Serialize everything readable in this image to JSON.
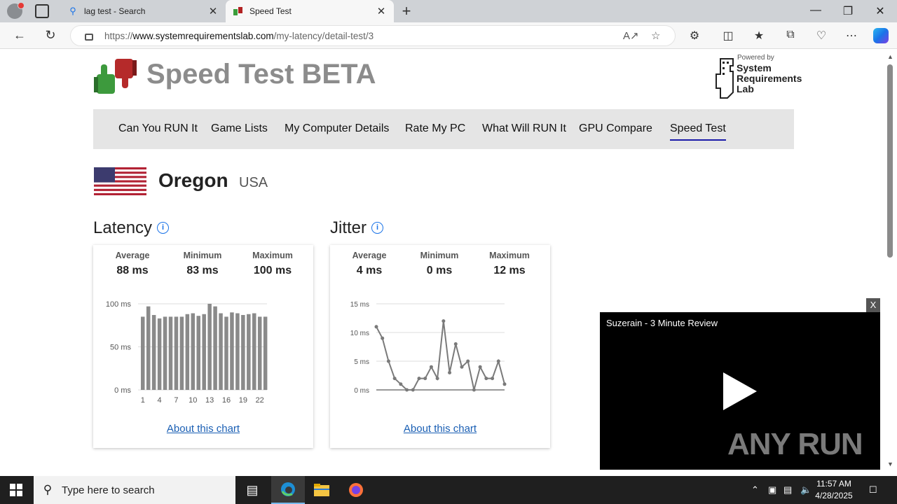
{
  "browser": {
    "tabs": [
      {
        "label": "lag test - Search",
        "icon": "search-icon",
        "active": false
      },
      {
        "label": "Speed Test",
        "icon": "srl-favicon",
        "active": true
      }
    ],
    "url_prefix": "https://",
    "url_domain": "www.systemrequirementslab.com",
    "url_path": "/my-latency/detail-test/3"
  },
  "site": {
    "title": "Speed Test BETA",
    "powered_by": "Powered by",
    "srl_lines": [
      "System",
      "Requirements",
      "Lab"
    ]
  },
  "menu": {
    "items": [
      {
        "label": "Can You RUN It",
        "active": false
      },
      {
        "label": "Game Lists",
        "active": false
      },
      {
        "label": "My Computer Details",
        "active": false
      },
      {
        "label": "Rate My PC",
        "active": false
      },
      {
        "label": "What Will RUN It",
        "active": false
      },
      {
        "label": "GPU Compare",
        "active": false
      },
      {
        "label": "Speed Test",
        "active": true
      }
    ]
  },
  "location": {
    "region": "Oregon",
    "country": "USA"
  },
  "latency": {
    "title": "Latency",
    "info": "i",
    "stats": [
      {
        "label": "Average",
        "value": "88 ms"
      },
      {
        "label": "Minimum",
        "value": "83 ms"
      },
      {
        "label": "Maximum",
        "value": "100 ms"
      }
    ],
    "about": "About this chart"
  },
  "jitter": {
    "title": "Jitter",
    "info": "i",
    "stats": [
      {
        "label": "Average",
        "value": "4 ms"
      },
      {
        "label": "Minimum",
        "value": "0 ms"
      },
      {
        "label": "Maximum",
        "value": "12 ms"
      }
    ],
    "about": "About this chart"
  },
  "chart_data": [
    {
      "type": "bar",
      "categories": [
        "1",
        "2",
        "3",
        "4",
        "5",
        "6",
        "7",
        "8",
        "9",
        "10",
        "11",
        "12",
        "13",
        "14",
        "15",
        "16",
        "17",
        "18",
        "19",
        "20",
        "21",
        "22",
        "23"
      ],
      "tick_labels": [
        "1",
        "4",
        "7",
        "10",
        "13",
        "16",
        "19",
        "22"
      ],
      "values": [
        85,
        97,
        87,
        83,
        85,
        85,
        85,
        85,
        88,
        89,
        86,
        88,
        100,
        97,
        89,
        85,
        90,
        89,
        87,
        88,
        89,
        85,
        85
      ],
      "ytick_labels": [
        "100 ms",
        "50 ms",
        "0 ms"
      ],
      "ylim": [
        0,
        100
      ],
      "color": "#8a8a8a"
    },
    {
      "type": "line",
      "x": [
        1,
        2,
        3,
        4,
        5,
        6,
        7,
        8,
        9,
        10,
        11,
        12,
        13,
        14,
        15,
        16,
        17,
        18,
        19,
        20,
        21,
        22
      ],
      "values": [
        11,
        9,
        5,
        2,
        1,
        0,
        0,
        2,
        2,
        4,
        2,
        12,
        3,
        8,
        4,
        5,
        0,
        4,
        2,
        2,
        5,
        1
      ],
      "ytick_labels": [
        "15 ms",
        "10 ms",
        "5 ms",
        "0 ms"
      ],
      "ylim": [
        0,
        15
      ],
      "color": "#7a7a7a"
    }
  ],
  "video": {
    "title": "Suzerain - 3 Minute Review",
    "close": "X",
    "watermark": "ANY RUN"
  },
  "taskbar": {
    "search_placeholder": "Type here to search",
    "time": "11:57 AM",
    "date": "4/28/2025"
  }
}
